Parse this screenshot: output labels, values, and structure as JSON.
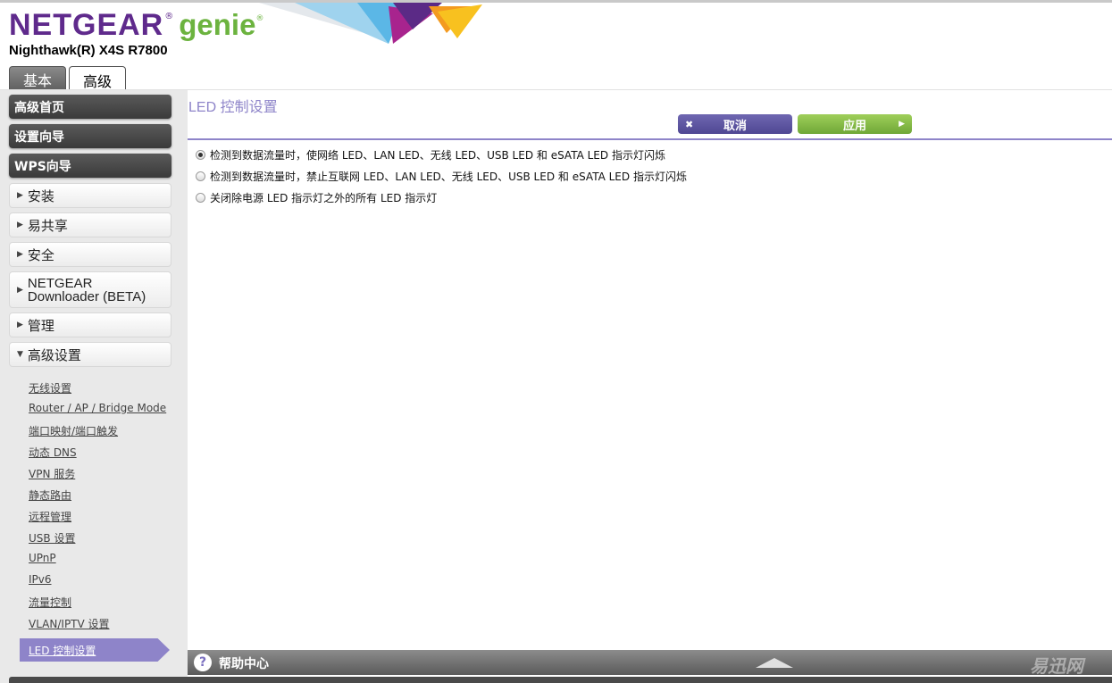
{
  "brand": {
    "netgear": "NETGEAR",
    "genie": "genie",
    "reg": "®",
    "model": "Nighthawk(R) X4S R7800",
    "purple": "#5f2a8c",
    "green": "#6cb33f"
  },
  "tabs": [
    {
      "label": "基本",
      "active": false
    },
    {
      "label": "高级",
      "active": true
    }
  ],
  "sidebar": {
    "dark_items": [
      {
        "label": "高级首页"
      },
      {
        "label": "设置向导"
      },
      {
        "label": "WPS向导"
      }
    ],
    "light_items": [
      {
        "label": "安装",
        "icon": "triangle-right-icon"
      },
      {
        "label": "易共享",
        "icon": "triangle-right-icon"
      },
      {
        "label": "安全",
        "icon": "triangle-right-icon"
      },
      {
        "label_line1": "NETGEAR",
        "label_line2": "Downloader (BETA)",
        "icon": "triangle-right-icon"
      },
      {
        "label": "管理",
        "icon": "triangle-right-icon"
      },
      {
        "label": "高级设置",
        "icon": "triangle-down-icon"
      }
    ],
    "sub_items": [
      {
        "label": "无线设置"
      },
      {
        "label": "Router / AP / Bridge Mode"
      },
      {
        "label": "端口映射/端口触发"
      },
      {
        "label": "动态 DNS"
      },
      {
        "label": "VPN 服务"
      },
      {
        "label": "静态路由"
      },
      {
        "label": "远程管理"
      },
      {
        "label": "USB 设置"
      },
      {
        "label": "UPnP"
      },
      {
        "label": "IPv6"
      },
      {
        "label": "流量控制"
      },
      {
        "label": "VLAN/IPTV 设置"
      }
    ],
    "active_sub": "LED 控制设置"
  },
  "main": {
    "title": "LED 控制设置",
    "cancel_label": "取消",
    "apply_label": "应用",
    "options": [
      {
        "label": "检测到数据流量时，使网络 LED、LAN LED、无线 LED、USB LED 和 eSATA LED 指示灯闪烁",
        "selected": true
      },
      {
        "label": "检测到数据流量时，禁止互联网 LED、LAN LED、无线 LED、USB LED 和 eSATA LED 指示灯闪烁",
        "selected": false
      },
      {
        "label": "关闭除电源 LED 指示灯之外的所有 LED 指示灯",
        "selected": false
      }
    ],
    "accent": "#8e84c9"
  },
  "help": {
    "icon_glyph": "?",
    "label": "帮助中心",
    "watermark": "易迅网"
  }
}
